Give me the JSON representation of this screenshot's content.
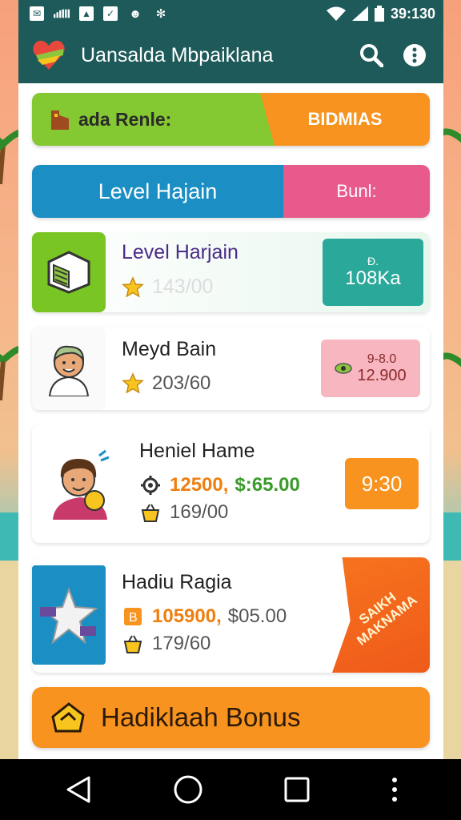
{
  "status": {
    "time": "39:130",
    "left_icons": [
      "message-icon",
      "signal-mini-icon",
      "photo-icon",
      "check-icon",
      "face-icon",
      "settings-icon"
    ]
  },
  "appbar": {
    "title": "Uansalda Mbpaiklana",
    "logo": "heart-logo-icon",
    "search_icon": "search-icon",
    "menu_icon": "more-vertical-icon"
  },
  "banner": {
    "left_label": "ada Renle:",
    "right_label": "BIDMIAS",
    "left_color": "#84c832",
    "right_color": "#f7931e"
  },
  "levelbar": {
    "left_label": "Level Hajain",
    "right_label": "Bunl:",
    "left_color": "#1b8fc4",
    "right_color": "#e8598c"
  },
  "cards": [
    {
      "title": "Level Harjain",
      "stat1": "143/00",
      "badge_top": "Đ.",
      "badge_main": "108Ka"
    },
    {
      "title": "Meyd Bain",
      "stat1": "203/60",
      "badge_top": "9-8.0",
      "badge_main": "12.900"
    },
    {
      "title": "Heniel Hame",
      "stat_price": "12500,",
      "stat_price2": "$:65.00",
      "stat2": "169/00",
      "badge_main": "9:30"
    },
    {
      "title": "Hadiu Ragia",
      "stat_price": "105900,",
      "stat_price2": "$05.00",
      "stat2": "179/60",
      "ribbon_line1": "SAIKH",
      "ribbon_line2": "MAKNAMA"
    }
  ],
  "bonus": {
    "label": "Hadiklaah Bonus",
    "color": "#f7931e"
  },
  "navbar": {
    "back_icon": "back-triangle-icon",
    "home_icon": "home-circle-icon",
    "recents_icon": "recents-square-icon",
    "more_icon": "more-dots-icon"
  }
}
